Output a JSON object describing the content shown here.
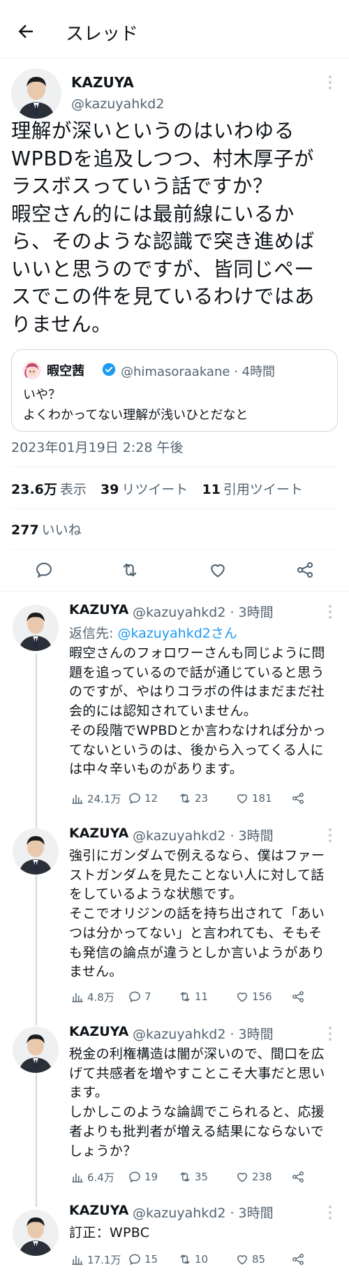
{
  "header": {
    "title": "スレッド"
  },
  "main_tweet": {
    "name": "KAZUYA",
    "handle": "@kazuyahkd2",
    "text": "理解が深いというのはいわゆる\nWPBDを追及しつつ、村木厚子が\nラスボスっていう話ですか？\n暇空さん的には最前線にいるか\nら、そのような認識で突き進めば\nいいと思うのですが、皆同じペー\nスでこの件を見ているわけではあ\nりません。",
    "quote": {
      "name": "暇空茜",
      "meta": "@himasoraakane · 4時間",
      "text": "いや？\nよくわかってない理解が浅いひとだなと"
    },
    "timestamp": "2023年01月19日 2:28 午後",
    "stats": {
      "views_value": "23.6万",
      "views_label": "表示",
      "retweets_value": "39",
      "retweets_label": "リツイート",
      "quotes_value": "11",
      "quotes_label": "引用ツイート",
      "likes_value": "277",
      "likes_label": "いいね"
    }
  },
  "replies": [
    {
      "name": "KAZUYA",
      "meta": "@kazuyahkd2 · 3時間",
      "reply_to_prefix": "返信先: ",
      "reply_to_handle": "@kazuyahkd2さん",
      "text": "暇空さんのフォロワーさんも同じように問\n題を追っているので話が通じていると思う\nのですが、やはりコラボの件はまだまだ社\n会的には認知されていません。\nその段階でWPBDとか言わなければ分かっ\nてないというのは、後から入ってくる人に\nは中々辛いものがあります。",
      "views": "24.1万",
      "replies": "12",
      "retweets": "23",
      "likes": "181"
    },
    {
      "name": "KAZUYA",
      "meta": "@kazuyahkd2 · 3時間",
      "text": "強引にガンダムで例えるなら、僕はファー\nストガンダムを見たことない人に対して話\nをしているような状態です。\nそこでオリジンの話を持ち出されて「あい\nつは分かってない」と言われても、そもそ\nも発信の論点が違うとしか言いようがあり\nません。",
      "views": "4.8万",
      "replies": "7",
      "retweets": "11",
      "likes": "156"
    },
    {
      "name": "KAZUYA",
      "meta": "@kazuyahkd2 · 3時間",
      "text": "税金の利権構造は闇が深いので、間口を広\nげて共感者を増やすことこそ大事だと思い\nます。\nしかしこのような論調でこられると、応援\n者よりも批判者が増える結果にならないで\nしょうか？",
      "views": "6.4万",
      "replies": "19",
      "retweets": "35",
      "likes": "238"
    },
    {
      "name": "KAZUYA",
      "meta": "@kazuyahkd2 · 3時間",
      "text": "訂正：WPBC",
      "views": "17.1万",
      "replies": "15",
      "retweets": "10",
      "likes": "85"
    }
  ],
  "colors": {
    "accent": "#1d9bf0",
    "text": "#0f1419",
    "secondary": "#536471",
    "border": "#eff3f4"
  }
}
